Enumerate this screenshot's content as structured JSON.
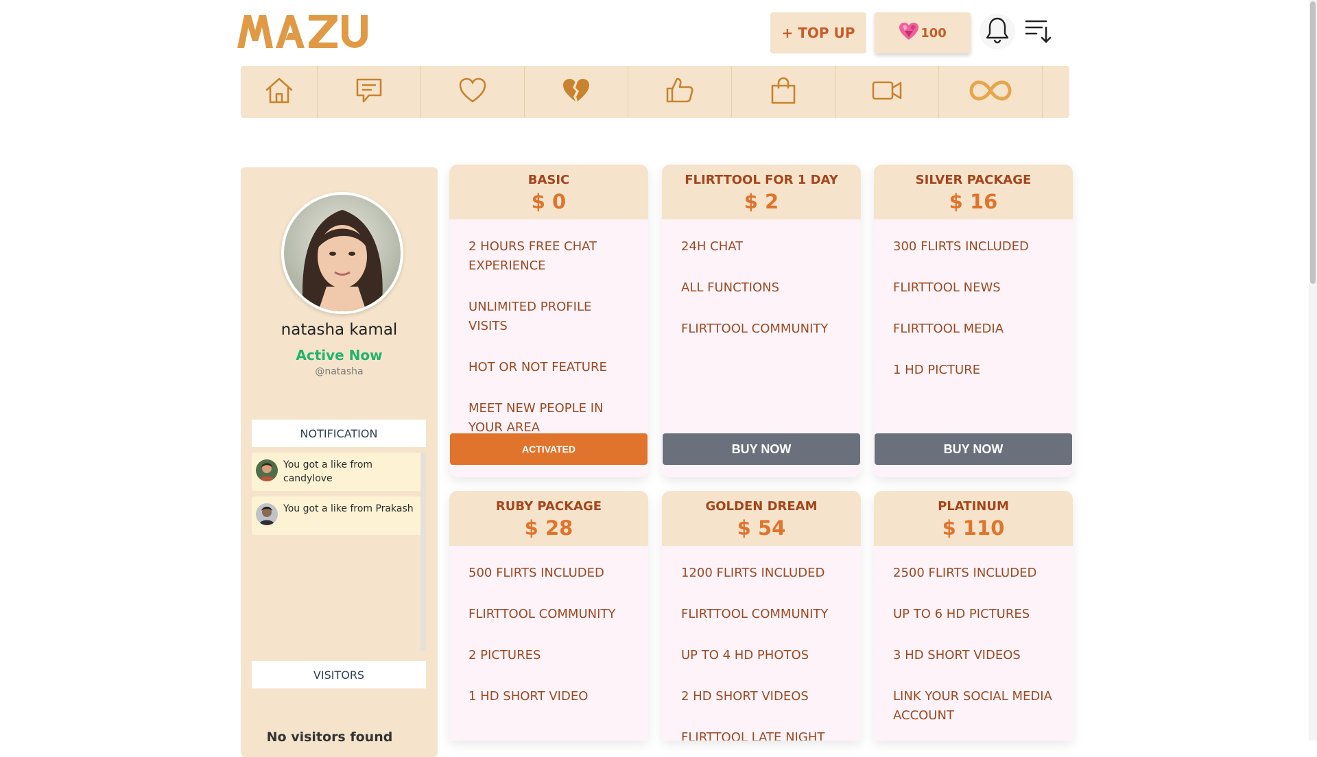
{
  "brand": {
    "logo_text": "MAZU",
    "color": "#e09a45"
  },
  "header": {
    "topup_label": "+ TOP UP",
    "credits_value": "100",
    "icons": [
      "diamond-heart-icon",
      "bell-icon",
      "sort-menu-icon"
    ]
  },
  "nav": {
    "items": [
      {
        "name": "home-icon"
      },
      {
        "name": "chat-icon"
      },
      {
        "name": "heart-icon"
      },
      {
        "name": "broken-heart-icon"
      },
      {
        "name": "thumbs-up-icon"
      },
      {
        "name": "shopping-bag-icon"
      },
      {
        "name": "video-icon"
      },
      {
        "name": "infinity-icon"
      }
    ]
  },
  "profile": {
    "name": "natasha kamal",
    "status": "Active Now",
    "handle": "@natasha"
  },
  "sidebar": {
    "notification_title": "NOTIFICATION",
    "notifications": [
      {
        "text": "You got a like from candylove"
      },
      {
        "text": "You got a like from Prakash"
      }
    ],
    "visitors_title": "VISITORS",
    "no_visitors": "No visitors found"
  },
  "packages": [
    {
      "title": "BASIC",
      "price": "$ 0",
      "features": [
        "2 HOURS FREE CHAT EXPERIENCE",
        "UNLIMITED PROFILE VISITS",
        "HOT OR NOT FEATURE",
        "MEET NEW PEOPLE IN YOUR AREA"
      ],
      "button": "ACTIVATED"
    },
    {
      "title": "FLIRTTOOL FOR 1 DAY",
      "price": "$ 2",
      "features": [
        "24H CHAT",
        "ALL FUNCTIONS",
        "FLIRTTOOL COMMUNITY"
      ],
      "button": "BUY NOW"
    },
    {
      "title": "SILVER PACKAGE",
      "price": "$ 16",
      "features": [
        "300 FLIRTS INCLUDED",
        "FLIRTTOOL NEWS",
        "FLIRTTOOL MEDIA",
        "1 HD PICTURE"
      ],
      "button": "BUY NOW"
    },
    {
      "title": "RUBY PACKAGE",
      "price": "$ 28",
      "features": [
        "500 FLIRTS INCLUDED",
        "FLIRTTOOL COMMUNITY",
        "2 PICTURES",
        "1 HD SHORT VIDEO"
      ]
    },
    {
      "title": "GOLDEN DREAM",
      "price": "$ 54",
      "features": [
        "1200 FLIRTS INCLUDED",
        "FLIRTTOOL COMMUNITY",
        "UP TO 4 HD PHOTOS",
        "2 HD SHORT VIDEOS",
        "FLIRTTOOL LATE NIGHT"
      ]
    },
    {
      "title": "PLATINUM",
      "price": "$ 110",
      "features": [
        "2500 FLIRTS INCLUDED",
        "UP TO 6 HD PICTURES",
        "3 HD SHORT VIDEOS",
        "LINK YOUR SOCIAL MEDIA ACCOUNT"
      ]
    }
  ],
  "colors": {
    "accent": "#e0742c",
    "panel": "#f5e4cb",
    "card_body": "#fdf3f8",
    "buy_button": "#6b717c",
    "active_status": "#23b26d"
  }
}
